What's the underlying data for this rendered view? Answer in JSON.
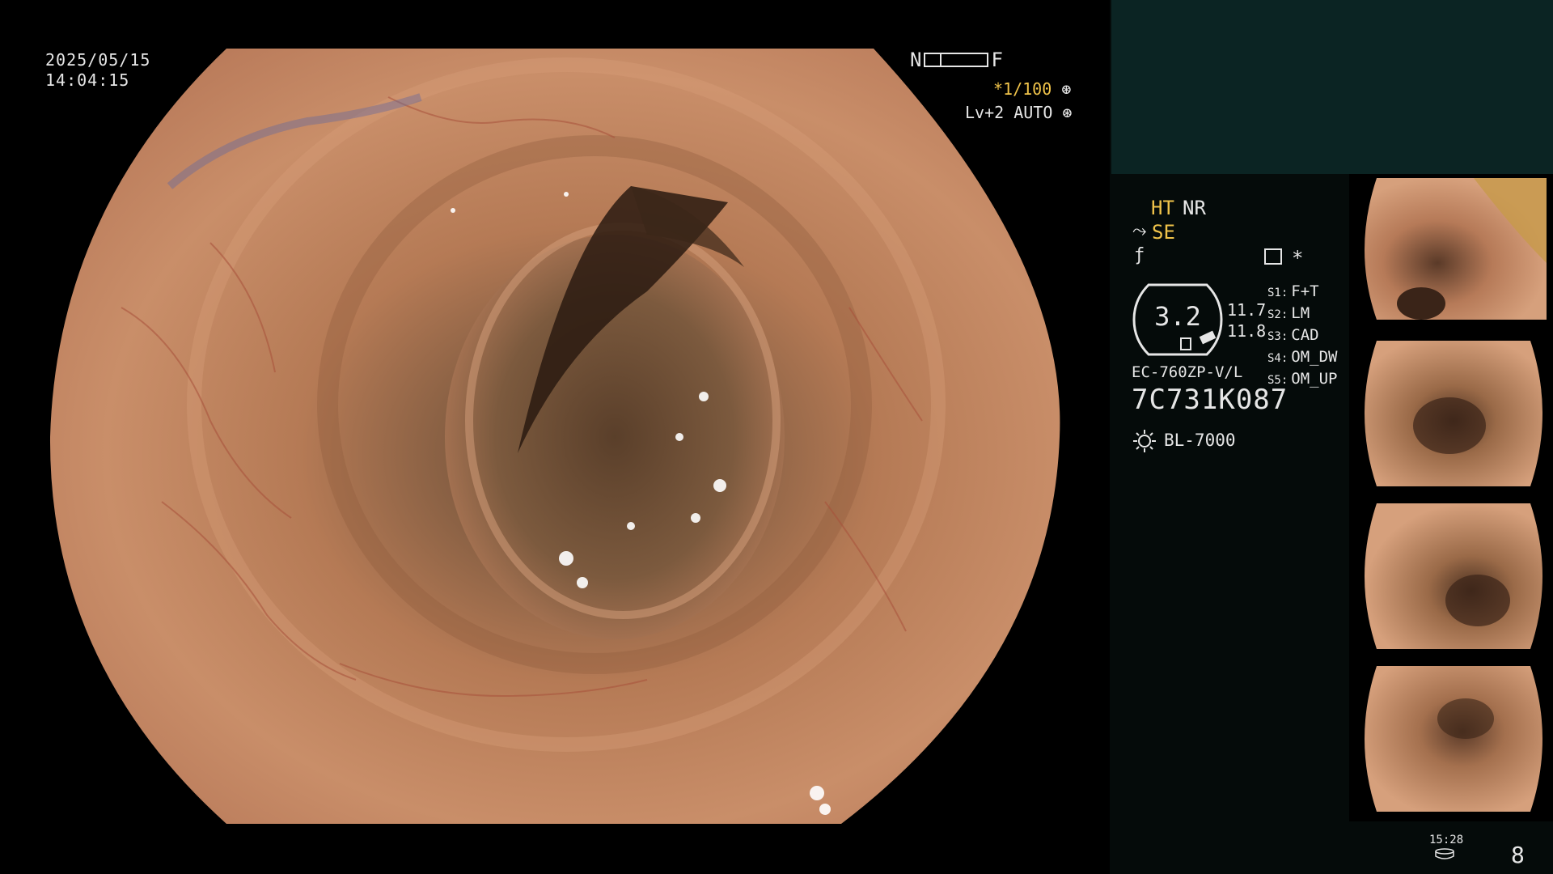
{
  "main": {
    "date": "2025/05/15",
    "time": "14:04:15",
    "nf": {
      "n": "N",
      "f": "F"
    },
    "shutter": {
      "prefix": "*",
      "value": "1/100",
      "icon": "aperture-icon"
    },
    "level": {
      "label": "Lv+2 AUTO",
      "icon": "iris-icon"
    }
  },
  "panel": {
    "ht": "HT",
    "nr": "NR",
    "se": "SE",
    "se_icon": "structure-enhance-icon",
    "f_icon": "filter-icon",
    "wave_icon": "image-mode-icon",
    "asterisk": "*",
    "magnification": "3.2",
    "val1": "11.7",
    "val2": "11.8",
    "scope_model": "EC-760ZP-V/L",
    "serial": "7C731K087",
    "lamp_icon": "light-source-icon",
    "lamp": "BL-7000",
    "switches": [
      {
        "key": "S1:",
        "value": "F+T"
      },
      {
        "key": "S2:",
        "value": "LM"
      },
      {
        "key": "S3:",
        "value": "CAD"
      },
      {
        "key": "S4:",
        "value": "OM_DW"
      },
      {
        "key": "S5:",
        "value": "OM_UP"
      }
    ],
    "counter_time": "15:28",
    "disk_icon": "storage-icon",
    "counter": "8"
  },
  "colors": {
    "accent": "#f0c34a",
    "header_bg": "#0b2423",
    "panel_bg": "#050b0a"
  }
}
